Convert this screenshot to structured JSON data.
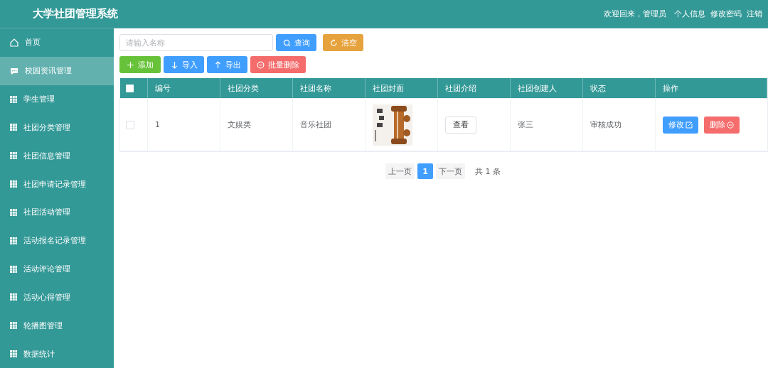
{
  "header": {
    "title": "大学社团管理系统",
    "welcome": "欢迎回来，管理员",
    "links": [
      "个人信息",
      "修改密码",
      "注销"
    ]
  },
  "sidebar": {
    "items": [
      {
        "label": "首页",
        "selected": false
      },
      {
        "label": "校园资讯管理",
        "selected": true
      },
      {
        "label": "学生管理",
        "selected": false
      },
      {
        "label": "社团分类管理",
        "selected": false
      },
      {
        "label": "社团信息管理",
        "selected": false
      },
      {
        "label": "社团申请记录管理",
        "selected": false
      },
      {
        "label": "社团活动管理",
        "selected": false
      },
      {
        "label": "活动报名记录管理",
        "selected": false
      },
      {
        "label": "活动评论管理",
        "selected": false
      },
      {
        "label": "活动心得管理",
        "selected": false
      },
      {
        "label": "轮播图管理",
        "selected": false
      },
      {
        "label": "数据统计",
        "selected": false
      }
    ]
  },
  "search": {
    "placeholder": "请输入名称",
    "buttons": [
      {
        "label": "查询",
        "kind": "query"
      },
      {
        "label": "清空",
        "kind": "clear"
      }
    ]
  },
  "toolbar": [
    {
      "label": "添加",
      "kind": "add"
    },
    {
      "label": "导入",
      "kind": "import"
    },
    {
      "label": "导出",
      "kind": "export"
    },
    {
      "label": "批量删除",
      "kind": "batch-delete"
    }
  ],
  "table": {
    "header_checked": false,
    "columns": [
      "编号",
      "社团分类",
      "社团名称",
      "社团封面",
      "社团介绍",
      "社团创建人",
      "状态",
      "操作"
    ],
    "rows": [
      {
        "checked": false,
        "id": "1",
        "category": "文娱类",
        "name": "音乐社团",
        "intro_button": "查看",
        "creator": "张三",
        "status": "审核成功",
        "edit_button": "修改",
        "delete_button": "删除"
      }
    ]
  },
  "pagination": {
    "prev": "上一页",
    "pages": [
      {
        "label": "1",
        "selected": true
      }
    ],
    "next": "下一页",
    "total": "共 1 条"
  }
}
